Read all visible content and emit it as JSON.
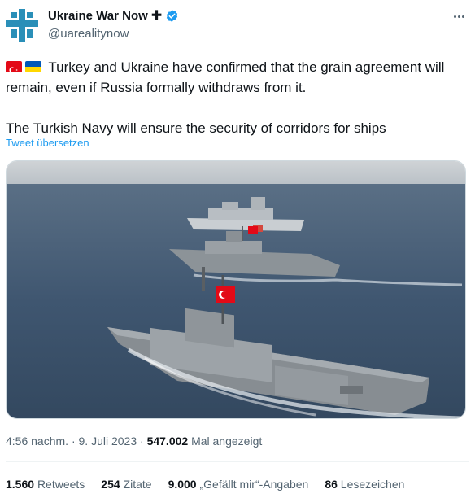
{
  "account": {
    "display_name": "Ukraine War Now",
    "handle": "@uarealitynow",
    "badge_icon": "verified-badge-icon",
    "plus_glyph": "✚",
    "avatar_colors": {
      "cross": "#2a8fb8",
      "bg": "#ffffff"
    }
  },
  "tweet": {
    "flags": [
      "turkey-flag-icon",
      "ukraine-flag-icon"
    ],
    "text_line1": "Turkey and Ukraine have confirmed that the grain agreement will remain, even if Russia formally withdraws from it.",
    "text_line2": "The Turkish Navy will ensure the security of corridors for ships",
    "translate_label": "Tweet übersetzen"
  },
  "meta": {
    "time": "4:56 nachm.",
    "sep1": " · ",
    "date": "9. Juli 2023",
    "sep2": " · ",
    "views_count": "547.002",
    "views_label": " Mal angezeigt"
  },
  "stats": {
    "retweets_count": "1.560",
    "retweets_label": "Retweets",
    "quotes_count": "254",
    "quotes_label": "Zitate",
    "likes_count": "9.000",
    "likes_label": "„Gefällt mir“-Angaben",
    "bookmarks_count": "86",
    "bookmarks_label": "Lesezeichen"
  },
  "colors": {
    "accent": "#1d9bf0",
    "secondary_text": "#536471",
    "primary_text": "#0f1419"
  }
}
